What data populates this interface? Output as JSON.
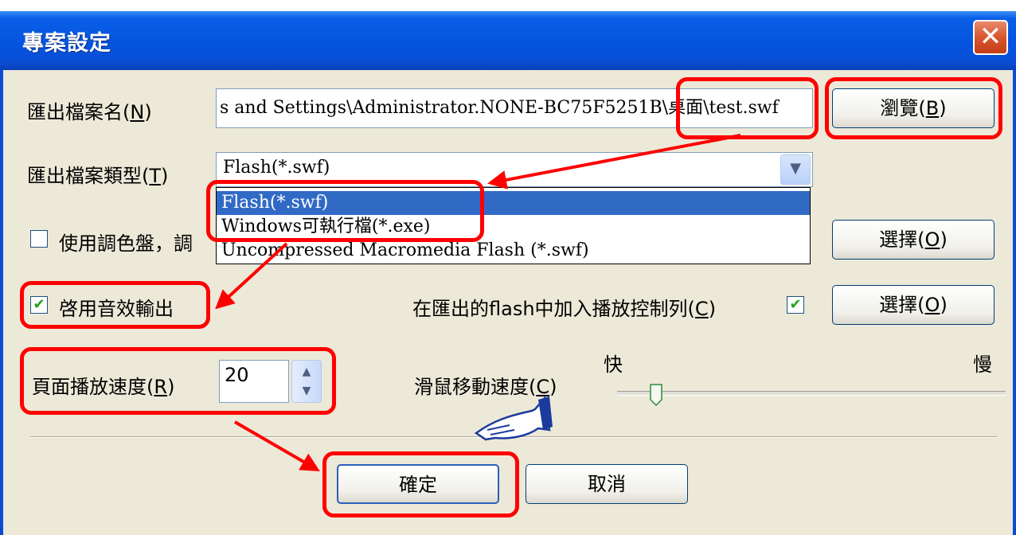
{
  "window": {
    "title": "專案設定",
    "close_glyph": "✕"
  },
  "export_name": {
    "label": "匯出檔案名",
    "hotkey": "N",
    "value": "s and Settings\\Administrator.NONE-BC75F5251B\\桌面\\test.swf",
    "browse_label": "瀏覽",
    "browse_hotkey": "B"
  },
  "export_type": {
    "label": "匯出檔案類型",
    "hotkey": "T",
    "selected": "Flash(*.swf)",
    "options": [
      "Flash(*.swf)",
      "Windows可執行檔(*.exe)",
      "Uncompressed Macromedia Flash (*.swf)"
    ]
  },
  "palette": {
    "label": "使用調色盤，",
    "label_tail": "調",
    "checked": false,
    "choose_label": "選擇",
    "choose_hotkey": "O"
  },
  "sound": {
    "label": "啓用音效輸出",
    "checked": true
  },
  "control_bar": {
    "label": "在匯出的flash中加入播放控制列",
    "hotkey": "C",
    "checked": true,
    "choose_label": "選擇",
    "choose_hotkey": "O"
  },
  "page_speed": {
    "label": "頁面播放速度",
    "hotkey": "R",
    "value": "20"
  },
  "mouse_speed": {
    "label": "滑鼠移動速度",
    "hotkey": "C",
    "fast_label": "快",
    "slow_label": "慢",
    "level": 0.1
  },
  "footer": {
    "ok_label": "確定",
    "cancel_label": "取消"
  },
  "colors": {
    "highlight": "#ff0000",
    "titlebar": "#0554e0",
    "selection": "#316ac5"
  },
  "icons": [
    "close-icon",
    "dropdown-arrow-icon",
    "checkbox-icon",
    "spin-up-icon",
    "spin-down-icon",
    "pointing-hand-icon"
  ]
}
